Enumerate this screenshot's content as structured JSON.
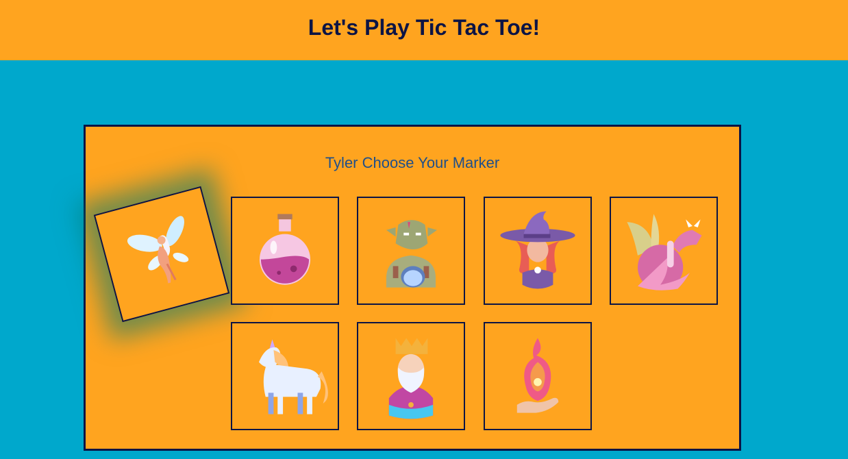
{
  "header": {
    "title": "Let's Play Tic Tac Toe!"
  },
  "board": {
    "prompt": "Tyler Choose Your Marker",
    "selected_marker": "fairy",
    "markers": [
      {
        "id": "fairy",
        "icon": "fairy-icon",
        "selected": true
      },
      {
        "id": "potion",
        "icon": "potion-icon",
        "selected": false
      },
      {
        "id": "orc",
        "icon": "orc-icon",
        "selected": false
      },
      {
        "id": "witch",
        "icon": "witch-icon",
        "selected": false
      },
      {
        "id": "dragon",
        "icon": "dragon-icon",
        "selected": false
      },
      {
        "id": "unicorn",
        "icon": "unicorn-icon",
        "selected": false
      },
      {
        "id": "king",
        "icon": "king-icon",
        "selected": false
      },
      {
        "id": "fire",
        "icon": "fire-hand-icon",
        "selected": false
      }
    ]
  },
  "colors": {
    "background": "#00a8cc",
    "header_bg": "#ffa41f",
    "board_bg": "#ffa41f",
    "text_dark": "#0c1445",
    "prompt_text": "#1f4f8a",
    "selected_glow": "#00786e"
  }
}
